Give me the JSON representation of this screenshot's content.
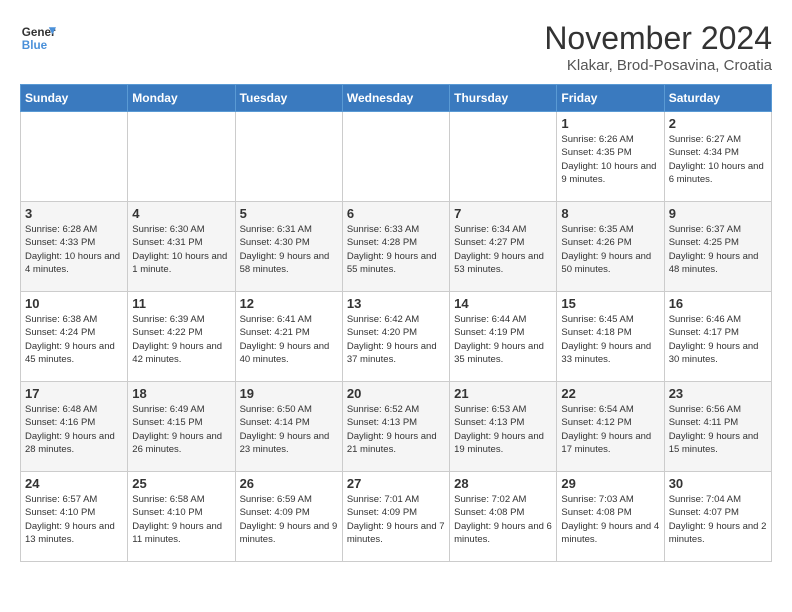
{
  "logo": {
    "line1": "General",
    "line2": "Blue"
  },
  "title": "November 2024",
  "subtitle": "Klakar, Brod-Posavina, Croatia",
  "days_header": [
    "Sunday",
    "Monday",
    "Tuesday",
    "Wednesday",
    "Thursday",
    "Friday",
    "Saturday"
  ],
  "weeks": [
    [
      {
        "day": "",
        "info": ""
      },
      {
        "day": "",
        "info": ""
      },
      {
        "day": "",
        "info": ""
      },
      {
        "day": "",
        "info": ""
      },
      {
        "day": "",
        "info": ""
      },
      {
        "day": "1",
        "info": "Sunrise: 6:26 AM\nSunset: 4:35 PM\nDaylight: 10 hours and 9 minutes."
      },
      {
        "day": "2",
        "info": "Sunrise: 6:27 AM\nSunset: 4:34 PM\nDaylight: 10 hours and 6 minutes."
      }
    ],
    [
      {
        "day": "3",
        "info": "Sunrise: 6:28 AM\nSunset: 4:33 PM\nDaylight: 10 hours and 4 minutes."
      },
      {
        "day": "4",
        "info": "Sunrise: 6:30 AM\nSunset: 4:31 PM\nDaylight: 10 hours and 1 minute."
      },
      {
        "day": "5",
        "info": "Sunrise: 6:31 AM\nSunset: 4:30 PM\nDaylight: 9 hours and 58 minutes."
      },
      {
        "day": "6",
        "info": "Sunrise: 6:33 AM\nSunset: 4:28 PM\nDaylight: 9 hours and 55 minutes."
      },
      {
        "day": "7",
        "info": "Sunrise: 6:34 AM\nSunset: 4:27 PM\nDaylight: 9 hours and 53 minutes."
      },
      {
        "day": "8",
        "info": "Sunrise: 6:35 AM\nSunset: 4:26 PM\nDaylight: 9 hours and 50 minutes."
      },
      {
        "day": "9",
        "info": "Sunrise: 6:37 AM\nSunset: 4:25 PM\nDaylight: 9 hours and 48 minutes."
      }
    ],
    [
      {
        "day": "10",
        "info": "Sunrise: 6:38 AM\nSunset: 4:24 PM\nDaylight: 9 hours and 45 minutes."
      },
      {
        "day": "11",
        "info": "Sunrise: 6:39 AM\nSunset: 4:22 PM\nDaylight: 9 hours and 42 minutes."
      },
      {
        "day": "12",
        "info": "Sunrise: 6:41 AM\nSunset: 4:21 PM\nDaylight: 9 hours and 40 minutes."
      },
      {
        "day": "13",
        "info": "Sunrise: 6:42 AM\nSunset: 4:20 PM\nDaylight: 9 hours and 37 minutes."
      },
      {
        "day": "14",
        "info": "Sunrise: 6:44 AM\nSunset: 4:19 PM\nDaylight: 9 hours and 35 minutes."
      },
      {
        "day": "15",
        "info": "Sunrise: 6:45 AM\nSunset: 4:18 PM\nDaylight: 9 hours and 33 minutes."
      },
      {
        "day": "16",
        "info": "Sunrise: 6:46 AM\nSunset: 4:17 PM\nDaylight: 9 hours and 30 minutes."
      }
    ],
    [
      {
        "day": "17",
        "info": "Sunrise: 6:48 AM\nSunset: 4:16 PM\nDaylight: 9 hours and 28 minutes."
      },
      {
        "day": "18",
        "info": "Sunrise: 6:49 AM\nSunset: 4:15 PM\nDaylight: 9 hours and 26 minutes."
      },
      {
        "day": "19",
        "info": "Sunrise: 6:50 AM\nSunset: 4:14 PM\nDaylight: 9 hours and 23 minutes."
      },
      {
        "day": "20",
        "info": "Sunrise: 6:52 AM\nSunset: 4:13 PM\nDaylight: 9 hours and 21 minutes."
      },
      {
        "day": "21",
        "info": "Sunrise: 6:53 AM\nSunset: 4:13 PM\nDaylight: 9 hours and 19 minutes."
      },
      {
        "day": "22",
        "info": "Sunrise: 6:54 AM\nSunset: 4:12 PM\nDaylight: 9 hours and 17 minutes."
      },
      {
        "day": "23",
        "info": "Sunrise: 6:56 AM\nSunset: 4:11 PM\nDaylight: 9 hours and 15 minutes."
      }
    ],
    [
      {
        "day": "24",
        "info": "Sunrise: 6:57 AM\nSunset: 4:10 PM\nDaylight: 9 hours and 13 minutes."
      },
      {
        "day": "25",
        "info": "Sunrise: 6:58 AM\nSunset: 4:10 PM\nDaylight: 9 hours and 11 minutes."
      },
      {
        "day": "26",
        "info": "Sunrise: 6:59 AM\nSunset: 4:09 PM\nDaylight: 9 hours and 9 minutes."
      },
      {
        "day": "27",
        "info": "Sunrise: 7:01 AM\nSunset: 4:09 PM\nDaylight: 9 hours and 7 minutes."
      },
      {
        "day": "28",
        "info": "Sunrise: 7:02 AM\nSunset: 4:08 PM\nDaylight: 9 hours and 6 minutes."
      },
      {
        "day": "29",
        "info": "Sunrise: 7:03 AM\nSunset: 4:08 PM\nDaylight: 9 hours and 4 minutes."
      },
      {
        "day": "30",
        "info": "Sunrise: 7:04 AM\nSunset: 4:07 PM\nDaylight: 9 hours and 2 minutes."
      }
    ]
  ]
}
